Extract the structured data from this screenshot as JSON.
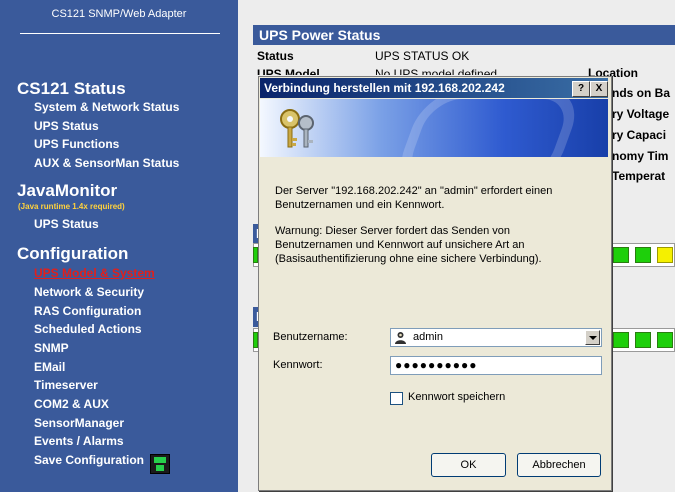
{
  "sidebar": {
    "adapter_title": "CS121 SNMP/Web Adapter",
    "sections": [
      {
        "title": "CS121 Status",
        "items": [
          "System & Network Status",
          "UPS Status",
          "UPS Functions",
          "AUX & SensorMan Status"
        ]
      },
      {
        "title": "JavaMonitor",
        "note": "(Java runtime 1.4x required)",
        "items": [
          "UPS Status"
        ]
      },
      {
        "title": "Configuration",
        "items": [
          "UPS Model & System",
          "Network & Security",
          "RAS Configuration",
          "Scheduled Actions",
          "SNMP",
          "EMail",
          "Timeserver",
          "COM2 & AUX",
          "SensorManager",
          "Events / Alarms",
          "Save Configuration"
        ]
      }
    ],
    "active_item": "UPS Model & System",
    "floppy_icon": "floppy-disk-icon"
  },
  "main": {
    "panel_title": "UPS Power Status",
    "status_label": "Status",
    "status_value": "UPS STATUS OK",
    "model_label_partial": "UPS Model",
    "model_value_partial": "No UPS model defined",
    "right_labels": [
      "Location",
      "nds on Ba",
      "ry Voltage",
      "ry Capaci",
      "nomy Tim",
      "Temperat"
    ],
    "bar_colors": {
      "green": "#1ecf0b",
      "yellow": "#f5f000"
    },
    "section2_letter": "L",
    "section3_letter": "B"
  },
  "dialog": {
    "title": "Verbindung herstellen mit 192.168.202.242",
    "help_button": "?",
    "close_button": "X",
    "message1_line1": "Der Server \"192.168.202.242\" an \"admin\" erfordert einen",
    "message1_line2": "Benutzernamen und ein Kennwort.",
    "message2_line1": "Warnung: Dieser Server fordert das Senden von",
    "message2_line2": "Benutzernamen und Kennwort auf unsichere Art an",
    "message2_line3": "(Basisauthentifizierung ohne eine sichere Verbindung).",
    "username_label": "Benutzername:",
    "username_value": "admin",
    "password_label": "Kennwort:",
    "password_masked": "●●●●●●●●●●",
    "remember_label": "Kennwort speichern",
    "remember_checked": false,
    "ok_label": "OK",
    "cancel_label": "Abbrechen",
    "icons": {
      "key": "keys-icon",
      "user": "user-icon"
    }
  }
}
